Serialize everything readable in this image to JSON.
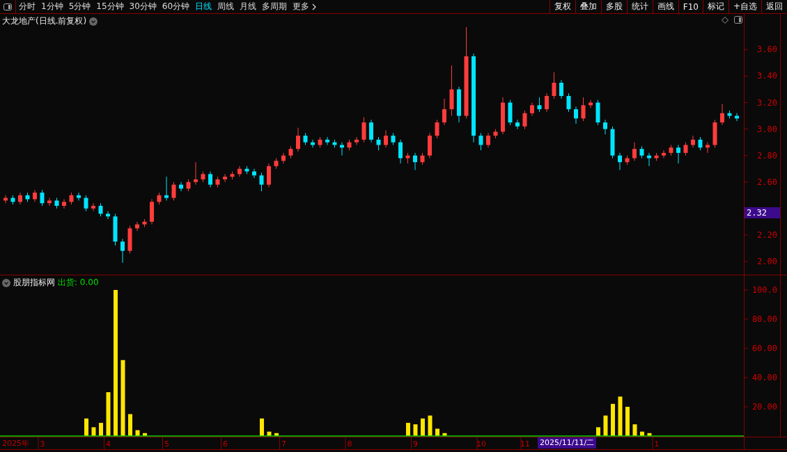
{
  "toolbar": {
    "tabs": [
      {
        "label": "分时",
        "selected": false
      },
      {
        "label": "1分钟",
        "selected": false
      },
      {
        "label": "5分钟",
        "selected": false
      },
      {
        "label": "15分钟",
        "selected": false
      },
      {
        "label": "30分钟",
        "selected": false
      },
      {
        "label": "60分钟",
        "selected": false
      },
      {
        "label": "日线",
        "selected": true
      },
      {
        "label": "周线",
        "selected": false
      },
      {
        "label": "月线",
        "selected": false
      },
      {
        "label": "多周期",
        "selected": false
      }
    ],
    "more": {
      "label": "更多"
    },
    "buttons": [
      "复权",
      "叠加",
      "多股",
      "统计",
      "画线",
      "F10",
      "标记",
      "+自选",
      "返回"
    ]
  },
  "price_panel": {
    "title": "大龙地产(日线.前复权)",
    "price_marker": "2.32",
    "chart_data": {
      "type": "candlestick",
      "ylim": [
        1.9,
        3.87
      ],
      "categories": [
        null,
        null,
        null,
        null,
        null,
        null,
        null,
        null,
        null,
        null,
        null,
        null,
        null,
        null,
        null,
        null,
        null,
        null,
        null,
        null,
        null,
        null,
        null,
        null,
        null,
        null,
        null,
        null,
        null,
        null,
        null,
        null,
        null,
        null,
        null,
        null,
        null,
        null,
        null,
        null,
        null,
        null,
        null,
        null,
        null,
        null,
        null,
        null,
        null,
        null,
        null,
        null,
        null,
        null,
        null,
        null,
        null,
        null,
        null,
        null,
        null,
        null,
        null,
        null,
        null,
        null,
        null,
        null,
        null,
        null,
        null,
        null,
        null,
        null,
        null,
        null,
        null,
        null,
        null,
        null,
        null,
        null,
        null,
        null,
        null,
        null,
        null,
        null,
        null,
        null,
        null,
        null,
        null,
        null,
        null,
        null,
        null,
        null,
        null,
        null,
        null
      ],
      "ohlc": [
        [
          2.46,
          2.5,
          2.44,
          2.48
        ],
        [
          2.48,
          2.5,
          2.43,
          2.45
        ],
        [
          2.45,
          2.52,
          2.43,
          2.5
        ],
        [
          2.5,
          2.52,
          2.45,
          2.47
        ],
        [
          2.47,
          2.54,
          2.45,
          2.52
        ],
        [
          2.52,
          2.54,
          2.42,
          2.44
        ],
        [
          2.44,
          2.48,
          2.42,
          2.46
        ],
        [
          2.46,
          2.48,
          2.4,
          2.42
        ],
        [
          2.42,
          2.47,
          2.4,
          2.45
        ],
        [
          2.45,
          2.52,
          2.43,
          2.5
        ],
        [
          2.5,
          2.52,
          2.46,
          2.48
        ],
        [
          2.48,
          2.5,
          2.38,
          2.4
        ],
        [
          2.4,
          2.44,
          2.38,
          2.42
        ],
        [
          2.42,
          2.44,
          2.34,
          2.36
        ],
        [
          2.36,
          2.38,
          2.32,
          2.34
        ],
        [
          2.34,
          2.36,
          2.12,
          2.15
        ],
        [
          2.15,
          2.17,
          1.99,
          2.08
        ],
        [
          2.08,
          2.27,
          2.06,
          2.25
        ],
        [
          2.25,
          2.3,
          2.23,
          2.28
        ],
        [
          2.28,
          2.32,
          2.26,
          2.3
        ],
        [
          2.3,
          2.47,
          2.28,
          2.45
        ],
        [
          2.45,
          2.52,
          2.43,
          2.5
        ],
        [
          2.5,
          2.64,
          2.46,
          2.48
        ],
        [
          2.48,
          2.6,
          2.46,
          2.58
        ],
        [
          2.58,
          2.6,
          2.53,
          2.55
        ],
        [
          2.55,
          2.62,
          2.53,
          2.6
        ],
        [
          2.6,
          2.75,
          2.58,
          2.62
        ],
        [
          2.62,
          2.68,
          2.6,
          2.66
        ],
        [
          2.66,
          2.68,
          2.56,
          2.58
        ],
        [
          2.58,
          2.64,
          2.56,
          2.62
        ],
        [
          2.62,
          2.66,
          2.6,
          2.64
        ],
        [
          2.64,
          2.68,
          2.62,
          2.66
        ],
        [
          2.66,
          2.72,
          2.64,
          2.7
        ],
        [
          2.7,
          2.72,
          2.66,
          2.68
        ],
        [
          2.68,
          2.7,
          2.63,
          2.65
        ],
        [
          2.65,
          2.67,
          2.53,
          2.58
        ],
        [
          2.58,
          2.74,
          2.56,
          2.72
        ],
        [
          2.72,
          2.78,
          2.7,
          2.76
        ],
        [
          2.76,
          2.82,
          2.74,
          2.8
        ],
        [
          2.8,
          2.87,
          2.78,
          2.85
        ],
        [
          2.85,
          3.01,
          2.83,
          2.95
        ],
        [
          2.95,
          2.97,
          2.88,
          2.9
        ],
        [
          2.9,
          2.92,
          2.86,
          2.88
        ],
        [
          2.88,
          2.94,
          2.86,
          2.92
        ],
        [
          2.92,
          2.94,
          2.88,
          2.9
        ],
        [
          2.9,
          2.92,
          2.86,
          2.88
        ],
        [
          2.88,
          2.9,
          2.8,
          2.86
        ],
        [
          2.86,
          2.92,
          2.84,
          2.9
        ],
        [
          2.9,
          2.94,
          2.88,
          2.92
        ],
        [
          2.92,
          3.09,
          2.9,
          3.05
        ],
        [
          3.05,
          3.07,
          2.9,
          2.92
        ],
        [
          2.92,
          2.94,
          2.84,
          2.88
        ],
        [
          2.88,
          2.99,
          2.86,
          2.95
        ],
        [
          2.95,
          2.97,
          2.88,
          2.9
        ],
        [
          2.9,
          2.92,
          2.74,
          2.78
        ],
        [
          2.78,
          2.82,
          2.74,
          2.8
        ],
        [
          2.8,
          2.82,
          2.69,
          2.75
        ],
        [
          2.75,
          2.82,
          2.73,
          2.8
        ],
        [
          2.8,
          2.97,
          2.78,
          2.95
        ],
        [
          2.95,
          3.07,
          2.93,
          3.05
        ],
        [
          3.05,
          3.23,
          3.03,
          3.15
        ],
        [
          3.15,
          3.48,
          3.1,
          3.3
        ],
        [
          3.3,
          3.32,
          3.05,
          3.1
        ],
        [
          3.1,
          3.77,
          3.08,
          3.55
        ],
        [
          3.55,
          3.57,
          2.9,
          2.95
        ],
        [
          2.95,
          2.97,
          2.84,
          2.88
        ],
        [
          2.88,
          2.97,
          2.86,
          2.95
        ],
        [
          2.95,
          3.0,
          2.93,
          2.98
        ],
        [
          2.98,
          3.24,
          2.96,
          3.2
        ],
        [
          3.2,
          3.22,
          3.03,
          3.05
        ],
        [
          3.05,
          3.07,
          3.0,
          3.02
        ],
        [
          3.02,
          3.14,
          3.0,
          3.12
        ],
        [
          3.12,
          3.2,
          3.1,
          3.18
        ],
        [
          3.18,
          3.24,
          3.13,
          3.15
        ],
        [
          3.15,
          3.27,
          3.13,
          3.25
        ],
        [
          3.25,
          3.43,
          3.23,
          3.35
        ],
        [
          3.35,
          3.37,
          3.23,
          3.25
        ],
        [
          3.25,
          3.27,
          3.13,
          3.15
        ],
        [
          3.15,
          3.17,
          3.04,
          3.08
        ],
        [
          3.08,
          3.24,
          3.06,
          3.18
        ],
        [
          3.18,
          3.22,
          3.16,
          3.2
        ],
        [
          3.2,
          3.22,
          3.03,
          3.05
        ],
        [
          3.05,
          3.07,
          2.96,
          3.0
        ],
        [
          3.0,
          3.02,
          2.78,
          2.8
        ],
        [
          2.8,
          2.82,
          2.69,
          2.75
        ],
        [
          2.75,
          2.8,
          2.73,
          2.78
        ],
        [
          2.78,
          2.9,
          2.76,
          2.85
        ],
        [
          2.85,
          2.87,
          2.78,
          2.8
        ],
        [
          2.8,
          2.82,
          2.72,
          2.78
        ],
        [
          2.78,
          2.82,
          2.76,
          2.8
        ],
        [
          2.8,
          2.84,
          2.78,
          2.82
        ],
        [
          2.82,
          2.88,
          2.8,
          2.86
        ],
        [
          2.86,
          2.88,
          2.74,
          2.82
        ],
        [
          2.82,
          2.9,
          2.8,
          2.88
        ],
        [
          2.88,
          2.95,
          2.86,
          2.92
        ],
        [
          2.92,
          2.94,
          2.84,
          2.86
        ],
        [
          2.86,
          2.9,
          2.82,
          2.88
        ],
        [
          2.88,
          3.07,
          2.86,
          3.05
        ],
        [
          3.05,
          3.19,
          3.03,
          3.12
        ],
        [
          3.12,
          3.14,
          3.08,
          3.1
        ],
        [
          3.1,
          3.12,
          3.06,
          3.08
        ]
      ],
      "yticks": [
        {
          "value": 3.6,
          "label": "3.60"
        },
        {
          "value": 3.4,
          "label": "3.40"
        },
        {
          "value": 3.2,
          "label": "3.20"
        },
        {
          "value": 3.0,
          "label": "3.00"
        },
        {
          "value": 2.8,
          "label": "2.80"
        },
        {
          "value": 2.6,
          "label": "2.60"
        },
        {
          "value": 2.2,
          "label": "2.20"
        },
        {
          "value": 2.0,
          "label": "2.00"
        }
      ]
    }
  },
  "indicator_panel": {
    "name": "股朋指标网",
    "reading": "出货: 0.00",
    "year_label": "2025年",
    "cursor_date": "2025/11/11/二",
    "chart_data": {
      "type": "bar",
      "ylim": [
        0,
        110
      ],
      "categories": [
        null,
        null,
        null,
        null,
        null,
        "3",
        null,
        null,
        null,
        null,
        null,
        null,
        null,
        null,
        "4",
        null,
        null,
        null,
        null,
        null,
        null,
        null,
        "5",
        null,
        null,
        null,
        null,
        null,
        null,
        null,
        "6",
        null,
        null,
        null,
        null,
        null,
        null,
        null,
        "7",
        null,
        null,
        null,
        null,
        null,
        null,
        null,
        null,
        "8",
        null,
        null,
        null,
        null,
        null,
        null,
        null,
        null,
        "9",
        null,
        null,
        null,
        null,
        null,
        null,
        null,
        null,
        "10",
        null,
        null,
        null,
        null,
        null,
        "11",
        null,
        null,
        null,
        null,
        null,
        null,
        null,
        null,
        null,
        null,
        null,
        null,
        null,
        null,
        null,
        null,
        null,
        "1",
        null,
        null,
        null,
        null,
        null,
        null,
        null,
        null,
        null,
        null,
        null
      ],
      "values": [
        0,
        0,
        0,
        0,
        0,
        0,
        0,
        0,
        0,
        0,
        0,
        12,
        6,
        9,
        30,
        100,
        52,
        15,
        4,
        2,
        0,
        0,
        0,
        0,
        0,
        0,
        0,
        0,
        0,
        0,
        0,
        0,
        0,
        0,
        0,
        12,
        3,
        2,
        0,
        0,
        0,
        0,
        0,
        0,
        0,
        0,
        0,
        0,
        0,
        0,
        0,
        0,
        0,
        0,
        0,
        9,
        8,
        12,
        14,
        5,
        2,
        0,
        0,
        0,
        0,
        0,
        0,
        0,
        0,
        0,
        0,
        0,
        0,
        0,
        0,
        0,
        0,
        0,
        0,
        0,
        0,
        6,
        14,
        22,
        27,
        20,
        8,
        3,
        2,
        0,
        0,
        0,
        0,
        0,
        0,
        0,
        0,
        0,
        0,
        0,
        0
      ],
      "yticks": [
        {
          "value": 100,
          "label": "100.0"
        },
        {
          "value": 80,
          "label": "80.00"
        },
        {
          "value": 60,
          "label": "60.00"
        },
        {
          "value": 40,
          "label": "40.00"
        },
        {
          "value": 20,
          "label": "20.00"
        }
      ]
    }
  }
}
